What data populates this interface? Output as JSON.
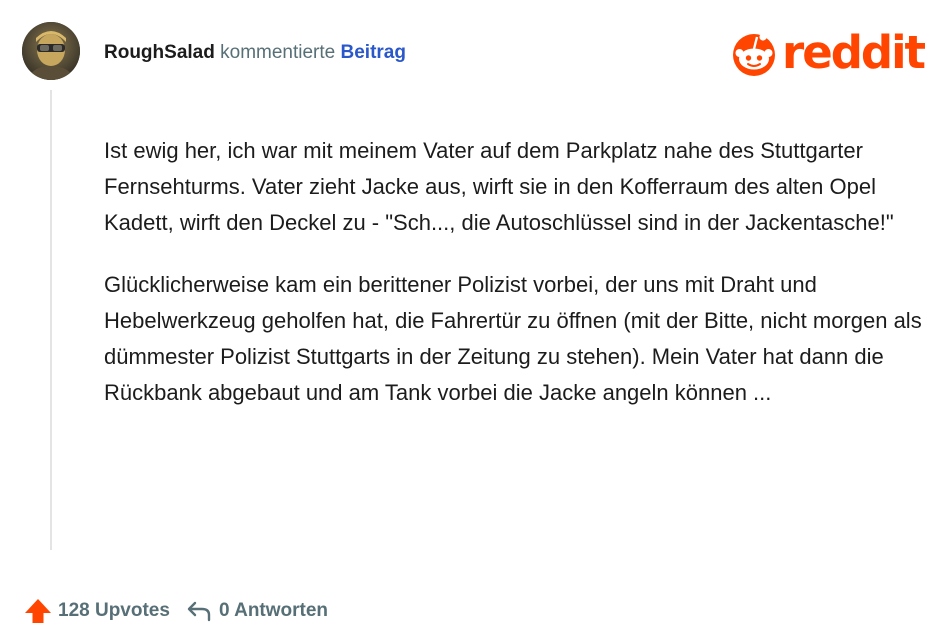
{
  "comment": {
    "username": "RoughSalad",
    "action": "kommentierte",
    "post_link": "Beitrag",
    "paragraphs": [
      "Ist ewig her, ich war mit meinem Vater auf dem Parkplatz nahe des Stuttgarter Fernsehturms. Vater zieht Jacke aus, wirft sie in den Kofferraum des alten Opel Kadett, wirft den Deckel zu - \"Sch..., die Autoschlüssel sind in der Jackentasche!\"",
      "Glücklicherweise kam ein berittener Polizist vorbei, der uns mit Draht und Hebelwerkzeug geholfen hat, die Fahrertür zu öffnen (mit der Bitte, nicht morgen als dümmester Polizist Stuttgarts in der Zeitung zu stehen). Mein Vater hat dann die Rückbank abgebaut und am Tank vorbei die Jacke angeln können ..."
    ]
  },
  "brand": {
    "name": "reddit",
    "color": "#ff4500",
    "icon": "reddit-snoo-icon"
  },
  "footer": {
    "upvotes": "128 Upvotes",
    "replies": "0 Antworten",
    "upvote_icon": "upvote-arrow-icon",
    "reply_icon": "reply-arrow-icon",
    "upvote_color": "#ff4500"
  }
}
